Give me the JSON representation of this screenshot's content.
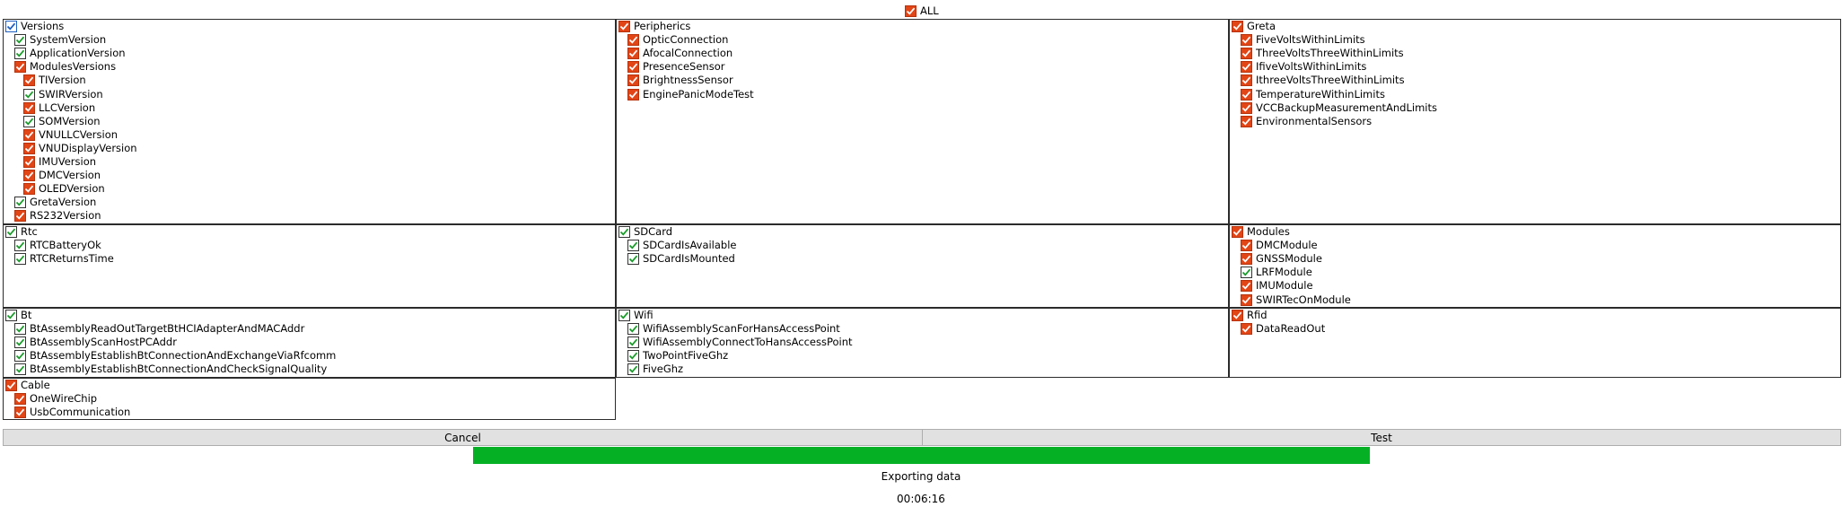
{
  "colors": {
    "checked_red": "#e24516",
    "check_green": "#1a9b2a",
    "check_blue": "#1f5fbf",
    "progress_green": "#06b025"
  },
  "all_label": "ALL",
  "groups": [
    {
      "label": "Versions",
      "style": "blue",
      "items": [
        {
          "label": "SystemVersion",
          "style": "green",
          "indent": 1
        },
        {
          "label": "ApplicationVersion",
          "style": "green",
          "indent": 1
        },
        {
          "label": "ModulesVersions",
          "style": "red",
          "indent": 1
        },
        {
          "label": "TIVersion",
          "style": "red",
          "indent": 2
        },
        {
          "label": "SWIRVersion",
          "style": "green",
          "indent": 2
        },
        {
          "label": "LLCVersion",
          "style": "red",
          "indent": 2
        },
        {
          "label": "SOMVersion",
          "style": "green",
          "indent": 2
        },
        {
          "label": "VNULLCVersion",
          "style": "red",
          "indent": 2
        },
        {
          "label": "VNUDisplayVersion",
          "style": "red",
          "indent": 2
        },
        {
          "label": "IMUVersion",
          "style": "red",
          "indent": 2
        },
        {
          "label": "DMCVersion",
          "style": "red",
          "indent": 2
        },
        {
          "label": "OLEDVersion",
          "style": "red",
          "indent": 2
        },
        {
          "label": "GretaVersion",
          "style": "green",
          "indent": 1
        },
        {
          "label": "RS232Version",
          "style": "red",
          "indent": 1
        }
      ]
    },
    {
      "label": "Peripherics",
      "style": "red",
      "items": [
        {
          "label": "OpticConnection",
          "style": "red",
          "indent": 1
        },
        {
          "label": "AfocalConnection",
          "style": "red",
          "indent": 1
        },
        {
          "label": "PresenceSensor",
          "style": "red",
          "indent": 1
        },
        {
          "label": "BrightnessSensor",
          "style": "red",
          "indent": 1
        },
        {
          "label": "EnginePanicModeTest",
          "style": "red",
          "indent": 1
        }
      ]
    },
    {
      "label": "Greta",
      "style": "red",
      "items": [
        {
          "label": "FiveVoltsWithinLimits",
          "style": "red",
          "indent": 1
        },
        {
          "label": "ThreeVoltsThreeWithinLimits",
          "style": "red",
          "indent": 1
        },
        {
          "label": "IfiveVoltsWithinLimits",
          "style": "red",
          "indent": 1
        },
        {
          "label": "IthreeVoltsThreeWithinLimits",
          "style": "red",
          "indent": 1
        },
        {
          "label": "TemperatureWithinLimits",
          "style": "red",
          "indent": 1
        },
        {
          "label": "VCCBackupMeasurementAndLimits",
          "style": "red",
          "indent": 1
        },
        {
          "label": "EnvironmentalSensors",
          "style": "red",
          "indent": 1
        }
      ]
    },
    {
      "label": "Rtc",
      "style": "green",
      "items": [
        {
          "label": "RTCBatteryOk",
          "style": "green",
          "indent": 1
        },
        {
          "label": "RTCReturnsTime",
          "style": "green",
          "indent": 1
        }
      ]
    },
    {
      "label": "SDCard",
      "style": "green",
      "items": [
        {
          "label": "SDCardIsAvailable",
          "style": "green",
          "indent": 1
        },
        {
          "label": "SDCardIsMounted",
          "style": "green",
          "indent": 1
        }
      ]
    },
    {
      "label": "Modules",
      "style": "red",
      "items": [
        {
          "label": "DMCModule",
          "style": "red",
          "indent": 1
        },
        {
          "label": "GNSSModule",
          "style": "red",
          "indent": 1
        },
        {
          "label": "LRFModule",
          "style": "green",
          "indent": 1
        },
        {
          "label": "IMUModule",
          "style": "red",
          "indent": 1
        },
        {
          "label": "SWIRTecOnModule",
          "style": "red",
          "indent": 1
        }
      ]
    },
    {
      "label": "Bt",
      "style": "green",
      "items": [
        {
          "label": "BtAssemblyReadOutTargetBtHCIAdapterAndMACAddr",
          "style": "green",
          "indent": 1
        },
        {
          "label": "BtAssemblyScanHostPCAddr",
          "style": "green",
          "indent": 1
        },
        {
          "label": "BtAssemblyEstablishBtConnectionAndExchangeViaRfcomm",
          "style": "green",
          "indent": 1
        },
        {
          "label": "BtAssemblyEstablishBtConnectionAndCheckSignalQuality",
          "style": "green",
          "indent": 1
        }
      ]
    },
    {
      "label": "Wifi",
      "style": "green",
      "items": [
        {
          "label": "WifiAssemblyScanForHansAccessPoint",
          "style": "green",
          "indent": 1
        },
        {
          "label": "WifiAssemblyConnectToHansAccessPoint",
          "style": "green",
          "indent": 1
        },
        {
          "label": "TwoPointFiveGhz",
          "style": "green",
          "indent": 1
        },
        {
          "label": "FiveGhz",
          "style": "green",
          "indent": 1
        }
      ]
    },
    {
      "label": "Rfid",
      "style": "red",
      "items": [
        {
          "label": "DataReadOut",
          "style": "red",
          "indent": 1
        }
      ]
    },
    {
      "label": "Cable",
      "style": "red",
      "items": [
        {
          "label": "OneWireChip",
          "style": "red",
          "indent": 1
        },
        {
          "label": "UsbCommunication",
          "style": "red",
          "indent": 1
        }
      ]
    }
  ],
  "buttons": {
    "cancel": "Cancel",
    "test": "Test"
  },
  "progress": {
    "fraction": 1.0
  },
  "status_text": "Exporting data",
  "elapsed_time": "00:06:16"
}
